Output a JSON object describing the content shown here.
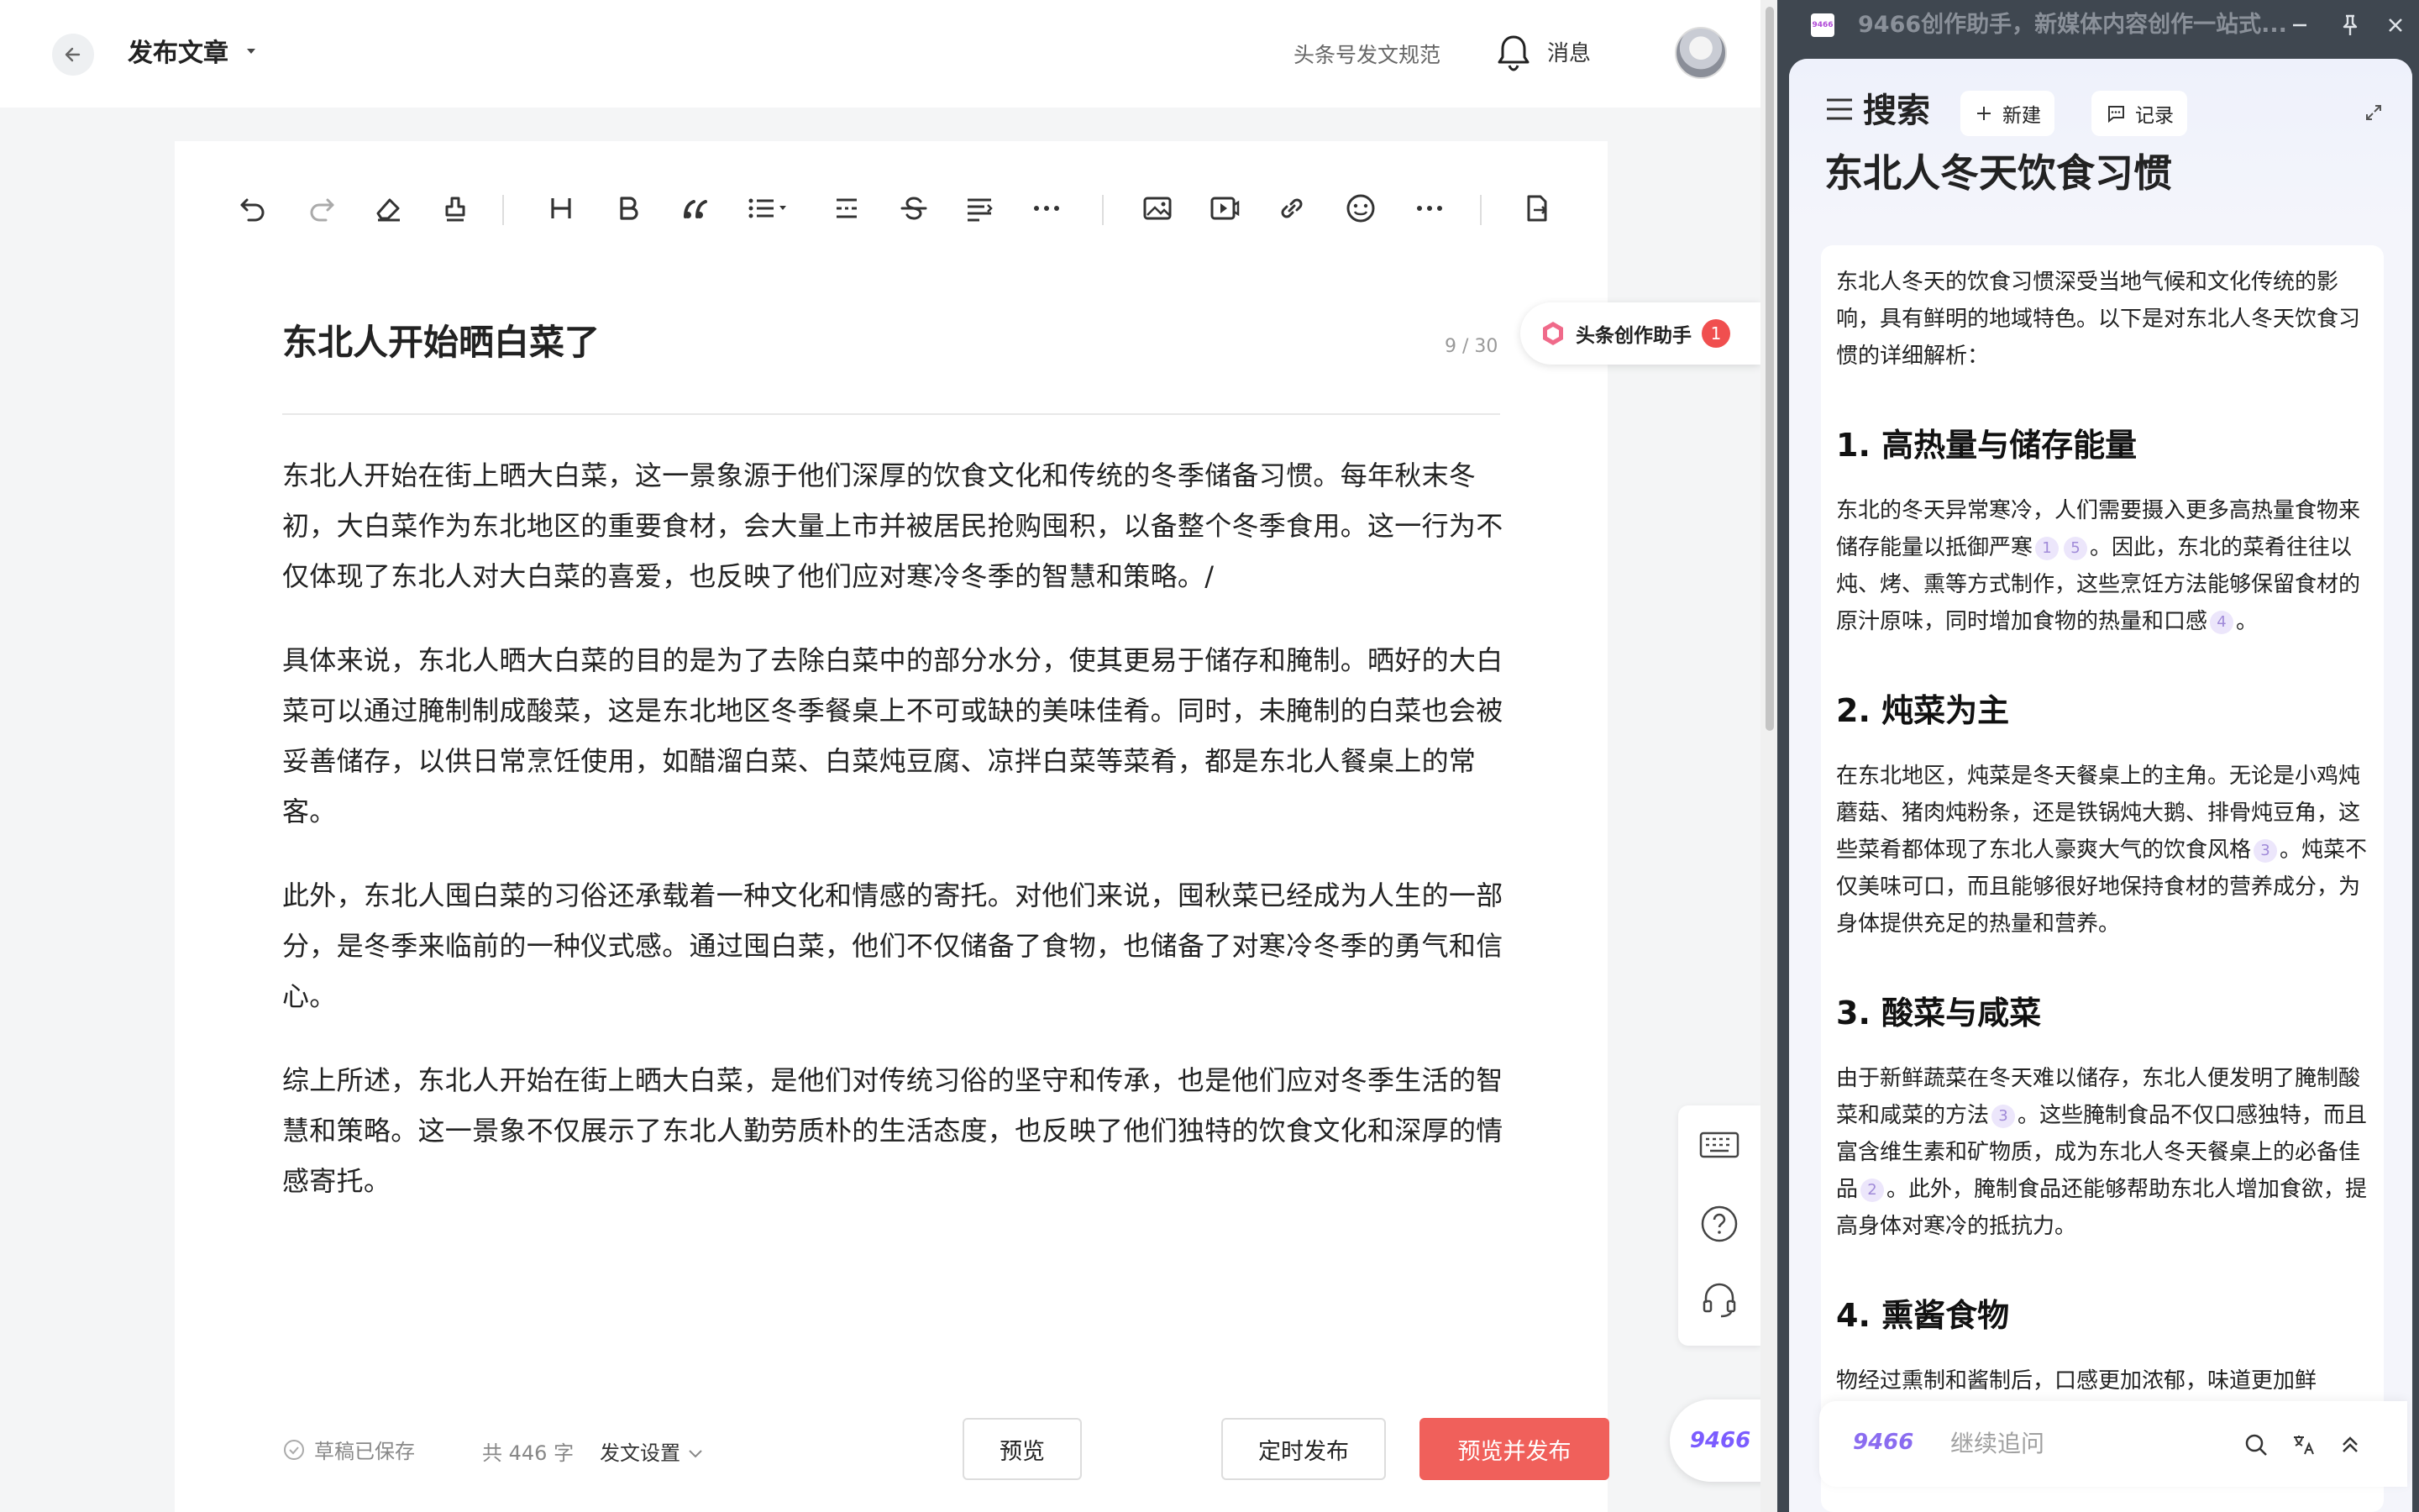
{
  "header": {
    "page_title": "发布文章",
    "rules_link": "头条号发文规范",
    "messages_label": "消息"
  },
  "editor": {
    "title": "东北人开始晒白菜了",
    "title_count": "9 / 30",
    "paragraphs": [
      "东北人开始在街上晒大白菜，这一景象源于他们深厚的饮食文化和传统的冬季储备习惯。每年秋末冬初，大白菜作为东北地区的重要食材，会大量上市并被居民抢购囤积，以备整个冬季食用。这一行为不仅体现了东北人对大白菜的喜爱，也反映了他们应对寒冷冬季的智慧和策略。/",
      "具体来说，东北人晒大白菜的目的是为了去除白菜中的部分水分，使其更易于储存和腌制。晒好的大白菜可以通过腌制制成酸菜，这是东北地区冬季餐桌上不可或缺的美味佳肴。同时，未腌制的白菜也会被妥善储存，以供日常烹饪使用，如醋溜白菜、白菜炖豆腐、凉拌白菜等菜肴，都是东北人餐桌上的常客。",
      "此外，东北人囤白菜的习俗还承载着一种文化和情感的寄托。对他们来说，囤秋菜已经成为人生的一部分，是冬季来临前的一种仪式感。通过囤白菜，他们不仅储备了食物，也储备了对寒冷冬季的勇气和信心。",
      "综上所述，东北人开始在街上晒大白菜，是他们对传统习俗的坚守和传承，也是他们应对冬季生活的智慧和策略。这一景象不仅展示了东北人勤劳质朴的生活态度，也反映了他们独特的饮食文化和深厚的情感寄托。"
    ]
  },
  "footer": {
    "saved_status": "草稿已保存",
    "word_count": "共 446 字",
    "publish_settings": "发文设置",
    "preview_label": "预览",
    "schedule_label": "定时发布",
    "publish_label": "预览并发布"
  },
  "assistant_pill": {
    "label": "头条创作助手",
    "badge": "1"
  },
  "floating_logo": "9466",
  "window": {
    "title": "9466创作助手，新媒体内容创作一站式...",
    "logo_text": "9466"
  },
  "panel": {
    "search_heading": "搜索",
    "new_label": "新建",
    "history_label": "记录",
    "query_title": "东北人冬天饮食习惯",
    "intro": "东北人冬天的饮食习惯深受当地气候和文化传统的影响，具有鲜明的地域特色。以下是对东北人冬天饮食习惯的详细解析：",
    "sections": [
      {
        "heading": "1. 高热量与储存能量"
      },
      {
        "heading": "2. 炖菜为主"
      },
      {
        "heading": "3. 酸菜与咸菜"
      },
      {
        "heading": "4. 熏酱食物"
      }
    ],
    "s1_a": "东北的冬天异常寒冷，人们需要摄入更多高热量食物来储存能量以抵御严寒",
    "s1_c1": "1",
    "s1_c2": "5",
    "s1_b": "。因此，东北的菜肴往往以炖、烤、熏等方式制作，这些烹饪方法能够保留食材的原汁原味，同时增加食物的热量和口感",
    "s1_c3": "4",
    "s1_c": "。",
    "s2_a": "在东北地区，炖菜是冬天餐桌上的主角。无论是小鸡炖蘑菇、猪肉炖粉条，还是铁锅炖大鹅、排骨炖豆角，这些菜肴都体现了东北人豪爽大气的饮食风格",
    "s2_c1": "3",
    "s2_b": "。炖菜不仅美味可口，而且能够很好地保持食材的营养成分，为身体提供充足的热量和营养。",
    "s3_a": "由于新鲜蔬菜在冬天难以储存，东北人便发明了腌制酸菜和咸菜的方法",
    "s3_c1": "3",
    "s3_b": "。这些腌制食品不仅口感独特，而且富含维生素和矿物质，成为东北人冬天餐桌上的必备佳品",
    "s3_c2": "2",
    "s3_c": "。此外，腌制食品还能够帮助东北人增加食欲，提高身体对寒冷的抵抗力。",
    "s4_a": "物经过熏制和酱制后，口感更加浓郁，味道更加鲜"
  },
  "followup": {
    "logo": "9466",
    "placeholder": "继续追问"
  },
  "colors": {
    "publish_red": "#f0605b",
    "accent_purple": "#8a6cf0",
    "window_frame": "#3f4750"
  }
}
